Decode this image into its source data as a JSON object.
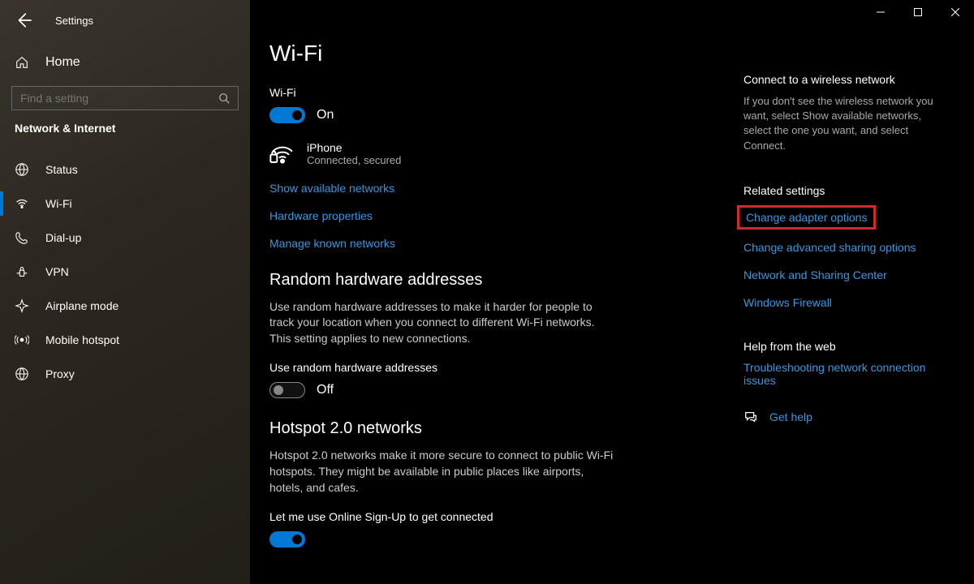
{
  "app": {
    "title": "Settings"
  },
  "sidebar": {
    "home": "Home",
    "search_placeholder": "Find a setting",
    "category": "Network & Internet",
    "items": [
      {
        "label": "Status"
      },
      {
        "label": "Wi-Fi"
      },
      {
        "label": "Dial-up"
      },
      {
        "label": "VPN"
      },
      {
        "label": "Airplane mode"
      },
      {
        "label": "Mobile hotspot"
      },
      {
        "label": "Proxy"
      }
    ]
  },
  "page": {
    "title": "Wi-Fi",
    "wifi_label": "Wi-Fi",
    "wifi_toggle_state": "On",
    "network": {
      "name": "iPhone",
      "status": "Connected, secured"
    },
    "links": {
      "show_networks": "Show available networks",
      "hw_props": "Hardware properties",
      "manage_known": "Manage known networks"
    },
    "random_hw": {
      "title": "Random hardware addresses",
      "desc": "Use random hardware addresses to make it harder for people to track your location when you connect to different Wi-Fi networks. This setting applies to new connections.",
      "toggle_label": "Use random hardware addresses",
      "toggle_state": "Off"
    },
    "hotspot": {
      "title": "Hotspot 2.0 networks",
      "desc": "Hotspot 2.0 networks make it more secure to connect to public Wi-Fi hotspots. They might be available in public places like airports, hotels, and cafes.",
      "toggle_label": "Let me use Online Sign-Up to get connected"
    }
  },
  "right": {
    "connect_heading": "Connect to a wireless network",
    "connect_text": "If you don't see the wireless network you want, select Show available networks, select the one you want, and select Connect.",
    "related_heading": "Related settings",
    "related": {
      "adapter": "Change adapter options",
      "sharing": "Change advanced sharing options",
      "center": "Network and Sharing Center",
      "firewall": "Windows Firewall"
    },
    "help_heading": "Help from the web",
    "help_link": "Troubleshooting network connection issues",
    "get_help": "Get help"
  }
}
